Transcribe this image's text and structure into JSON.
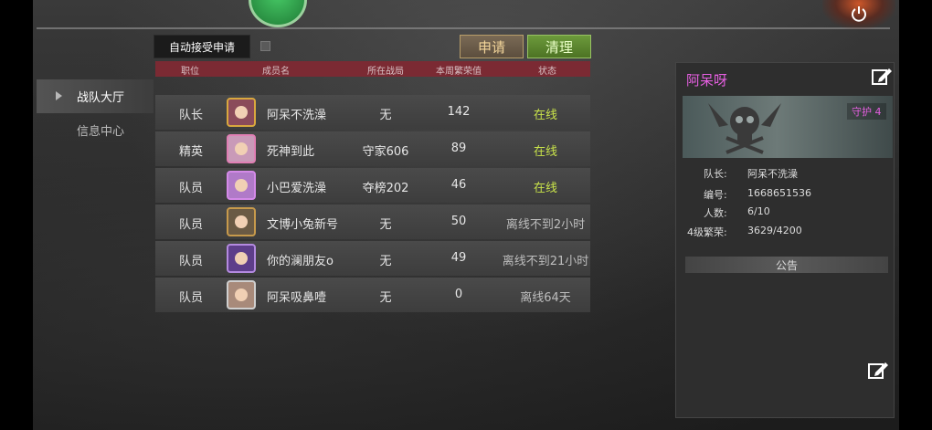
{
  "top": {
    "auto_accept_label": "自动接受申请",
    "apply_label": "申请",
    "clean_label": "清理"
  },
  "nav": {
    "items": [
      {
        "label": "战队大厅",
        "active": true
      },
      {
        "label": "信息中心",
        "active": false
      }
    ]
  },
  "table": {
    "headers": [
      "职位",
      "成员名",
      "所在战局",
      "本周繁荣值",
      "状态"
    ],
    "rows": [
      {
        "role": "队长",
        "name": "阿呆不洗澡",
        "match": "无",
        "prosperity": "142",
        "status": "在线",
        "online": true,
        "frame": "#d9a83e",
        "bg": "#8a4b5a"
      },
      {
        "role": "精英",
        "name": "死神到此",
        "match": "守家606",
        "prosperity": "89",
        "status": "在线",
        "online": true,
        "frame": "#e07fb4",
        "bg": "#c99ab8"
      },
      {
        "role": "队员",
        "name": "小巴爱洗澡",
        "match": "夺榜202",
        "prosperity": "46",
        "status": "在线",
        "online": true,
        "frame": "#d48ae8",
        "bg": "#b07ac8"
      },
      {
        "role": "队员",
        "name": "文博小兔新号",
        "match": "无",
        "prosperity": "50",
        "status": "离线不到2小时",
        "online": false,
        "frame": "#c79a4c",
        "bg": "#6a5a44"
      },
      {
        "role": "队员",
        "name": "你的澜朋友o",
        "match": "无",
        "prosperity": "49",
        "status": "离线不到21小时",
        "online": false,
        "frame": "#b48ae0",
        "bg": "#5e3e8a"
      },
      {
        "role": "队员",
        "name": "阿呆吸鼻噎",
        "match": "无",
        "prosperity": "0",
        "status": "离线64天",
        "online": false,
        "frame": "#cfcfcf",
        "bg": "#a88a7a"
      }
    ]
  },
  "team": {
    "name": "阿呆呀",
    "rank": "守护 4",
    "captain_label": "队长:",
    "captain": "阿呆不洗澡",
    "id_label": "编号:",
    "id": "1668651536",
    "members_label": "人数:",
    "members": "6/10",
    "prosperity_label": "4级繁荣:",
    "prosperity": "3629/4200",
    "notice_label": "公告"
  }
}
